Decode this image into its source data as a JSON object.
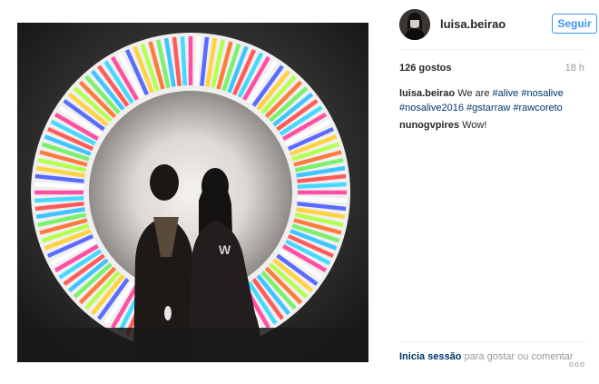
{
  "post": {
    "username": "luisa.beirao",
    "follow_label": "Seguir",
    "likes_text": "126 gostos",
    "time_text": "18 h"
  },
  "comments": [
    {
      "user": "luisa.beirao",
      "text": "We are",
      "hashtags": [
        "#alive",
        "#nosalive",
        "#nosalive2016",
        "#gstarraw",
        "#rawcoreto"
      ]
    },
    {
      "user": "nunogvpires",
      "text": "Wow!"
    }
  ],
  "footer": {
    "login_label": "Inicia sessão",
    "rest_text": "para gostar ou comentar",
    "more_label": "ooo"
  },
  "photo": {
    "subject": "silhouettes of two people in front of a rainbow light ring"
  },
  "colors": {
    "link": "#003569",
    "follow": "#3897f0",
    "muted": "#999999"
  }
}
